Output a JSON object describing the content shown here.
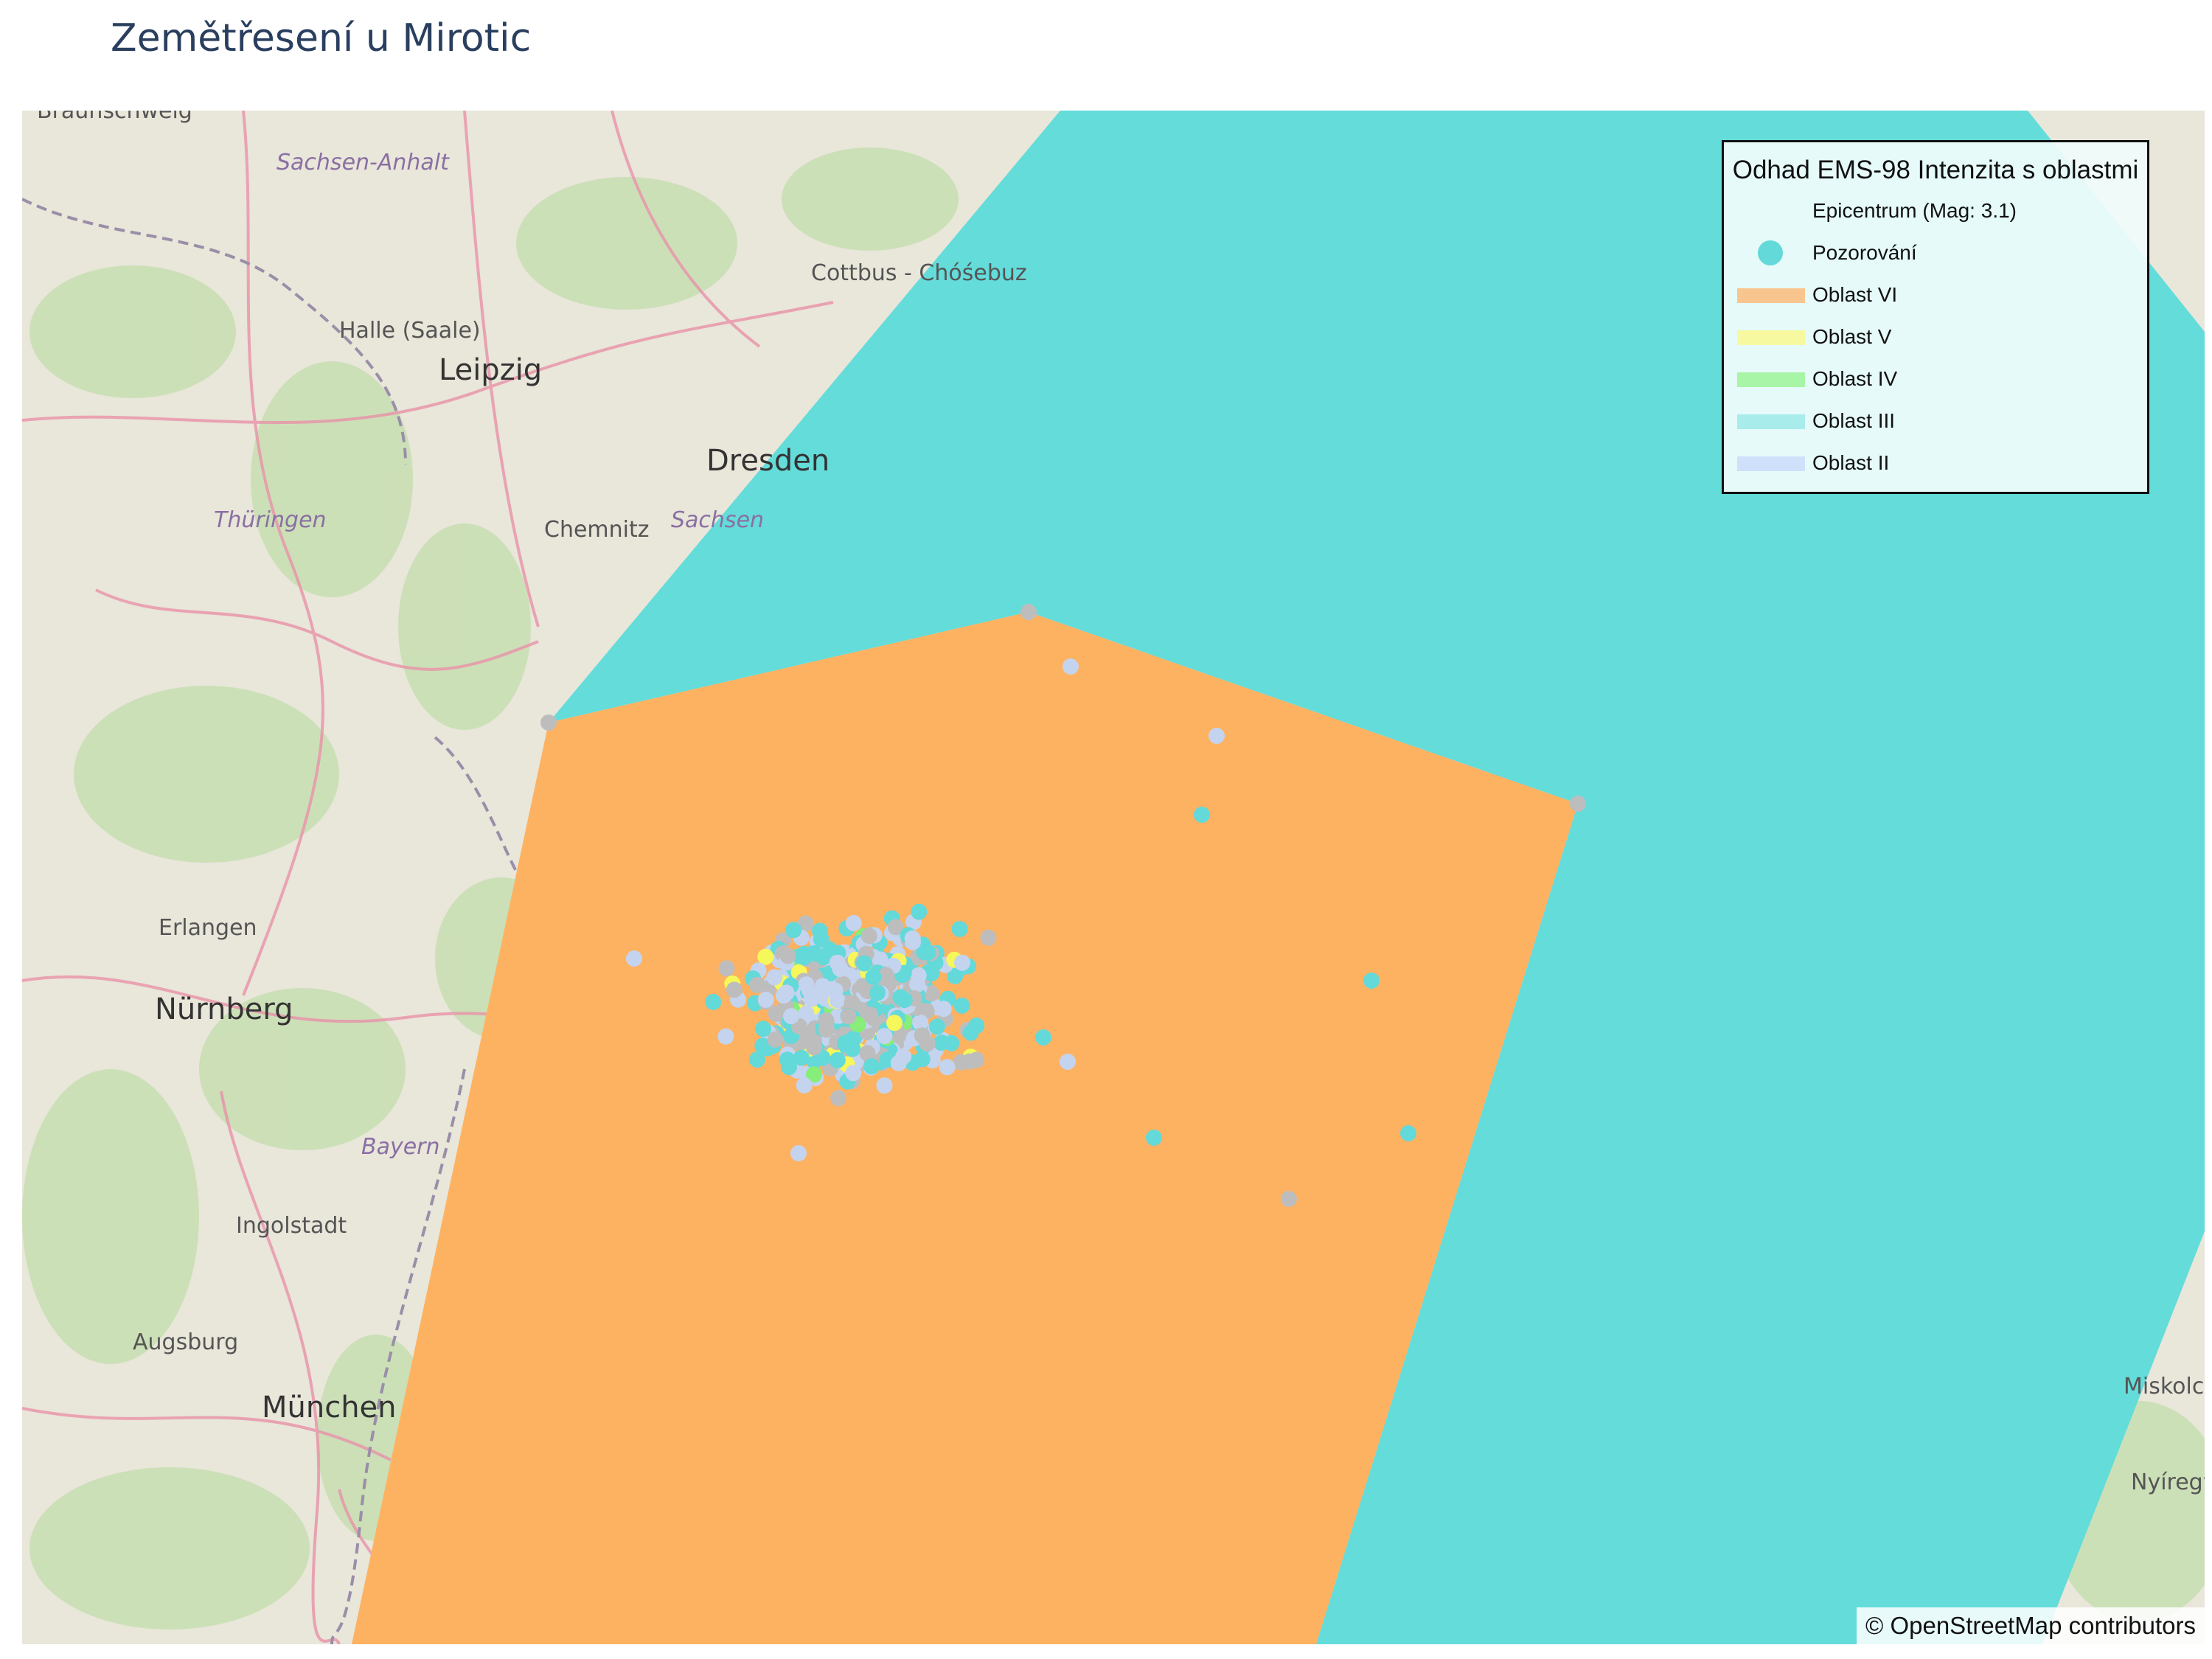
{
  "title": "Zemětřesení u Mirotic",
  "legend": {
    "title": "Odhad EMS-98 Intenzita s oblastmi",
    "items": [
      {
        "label": "Epicentrum (Mag: 3.1)",
        "kind": "marker-hidden",
        "color": "#ffffff"
      },
      {
        "label": "Pozorování",
        "kind": "dot",
        "color": "#63d9d9"
      },
      {
        "label": "Oblast VI",
        "kind": "line",
        "color": "#f9c58f"
      },
      {
        "label": "Oblast V",
        "kind": "line",
        "color": "#f7f9a0"
      },
      {
        "label": "Oblast IV",
        "kind": "line",
        "color": "#a8f5a8"
      },
      {
        "label": "Oblast III",
        "kind": "line",
        "color": "#a9ecec"
      },
      {
        "label": "Oblast II",
        "kind": "line",
        "color": "#cfe0fb"
      }
    ]
  },
  "attribution": "© OpenStreetMap contributors",
  "colors": {
    "zone_vi": "#fdb262",
    "zone_iii": "#63dcda",
    "obs_iii": "#63d9d9",
    "obs_ii": "#c4d4ef",
    "obs_grey": "#bdbdbd",
    "obs_v": "#f5f75a",
    "obs_iv": "#86ee79"
  },
  "map_labels": [
    "Braunschweig",
    "Sachsen-Anhalt",
    "Cottbus - Chóśebuz",
    "Halle (Saale)",
    "Leipzig",
    "Dresden",
    "Thüringen",
    "Chemnitz",
    "Sachsen",
    "Erlangen",
    "Nürnberg",
    "Bayern",
    "Ingolstadt",
    "Augsburg",
    "München",
    "Miskolc",
    "Nyíregyháza"
  ]
}
